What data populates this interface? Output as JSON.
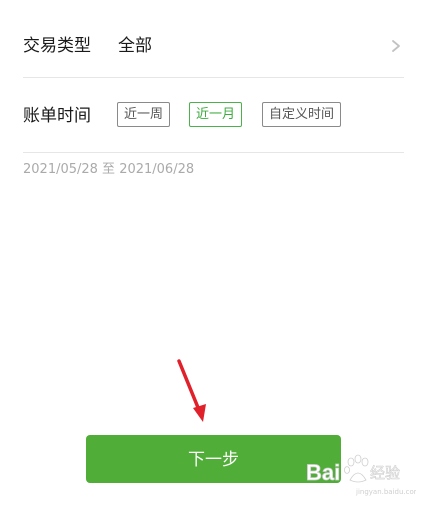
{
  "transaction_type": {
    "label": "交易类型",
    "value": "全部",
    "icon": "chevron-right-icon"
  },
  "bill_time": {
    "label": "账单时间",
    "options": [
      "近一周",
      "近一月",
      "自定义时间"
    ],
    "selected_index": 1,
    "range_text": "2021/05/28 至 2021/06/28"
  },
  "next_button": {
    "label": "下一步"
  },
  "watermark": {
    "text": "Bai 经验"
  },
  "colors": {
    "accent": "#50ad38",
    "selected_chip": "#3caa3c",
    "arrow": "#e0202a",
    "muted_text": "#aaaaaa"
  }
}
